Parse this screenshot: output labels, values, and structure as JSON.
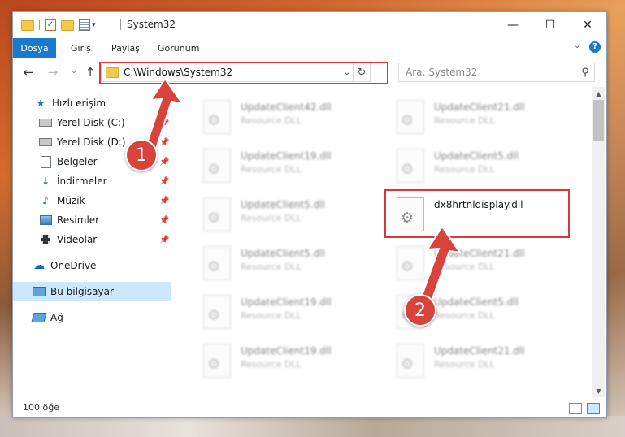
{
  "window": {
    "title": "System32",
    "controls": {
      "minimize": "—",
      "maximize": "☐",
      "close": "✕"
    }
  },
  "ribbon": {
    "tabs": [
      "Dosya",
      "Giriş",
      "Paylaş",
      "Görünüm"
    ],
    "expand_icon": "chevron-down-icon",
    "help_label": "?"
  },
  "address": {
    "path": "C:\\Windows\\System32",
    "search_placeholder": "Ara: System32"
  },
  "nav": {
    "quick_access": "Hızlı erişim",
    "items": [
      {
        "label": "Yerel Disk (C:)",
        "icon": "drive-icon",
        "pinned": true
      },
      {
        "label": "Yerel Disk (D:)",
        "icon": "drive-icon",
        "pinned": true
      },
      {
        "label": "Belgeler",
        "icon": "documents-icon",
        "pinned": true
      },
      {
        "label": "İndirmeler",
        "icon": "downloads-icon",
        "pinned": true
      },
      {
        "label": "Müzik",
        "icon": "music-icon",
        "pinned": true
      },
      {
        "label": "Resimler",
        "icon": "pictures-icon",
        "pinned": true
      },
      {
        "label": "Videolar",
        "icon": "videos-icon",
        "pinned": true
      }
    ],
    "onedrive": "OneDrive",
    "this_pc": "Bu bilgisayar",
    "network": "Ağ"
  },
  "files": {
    "left": [
      {
        "name": "UpdateClient42.dll",
        "type": "Resource DLL"
      },
      {
        "name": "UpdateClient19.dll",
        "type": "Resource DLL"
      },
      {
        "name": "UpdateClient5.dll",
        "type": "Resource DLL"
      },
      {
        "name": "UpdateClient5.dll",
        "type": "Resource DLL"
      },
      {
        "name": "UpdateClient19.dll",
        "type": "Resource DLL"
      },
      {
        "name": "UpdateClient19.dll",
        "type": "Resource DLL"
      }
    ],
    "right": [
      {
        "name": "UpdateClient21.dll",
        "type": "Resource DLL"
      },
      {
        "name": "UpdateClient5.dll",
        "type": "Resource DLL"
      },
      {
        "name": "dx8hrtnldisplay.dll",
        "type": "",
        "highlighted": true
      },
      {
        "name": "UpdateClient21.dll",
        "type": "Resource DLL"
      },
      {
        "name": "UpdateClient5.dll",
        "type": "Resource DLL"
      },
      {
        "name": "UpdateClient21.dll",
        "type": "Resource DLL"
      }
    ]
  },
  "status": {
    "count": "100 öğe"
  },
  "callouts": {
    "one": "1",
    "two": "2"
  },
  "colors": {
    "accent": "#1979ca",
    "callout": "#d8443b",
    "selection": "#cce8ff"
  }
}
